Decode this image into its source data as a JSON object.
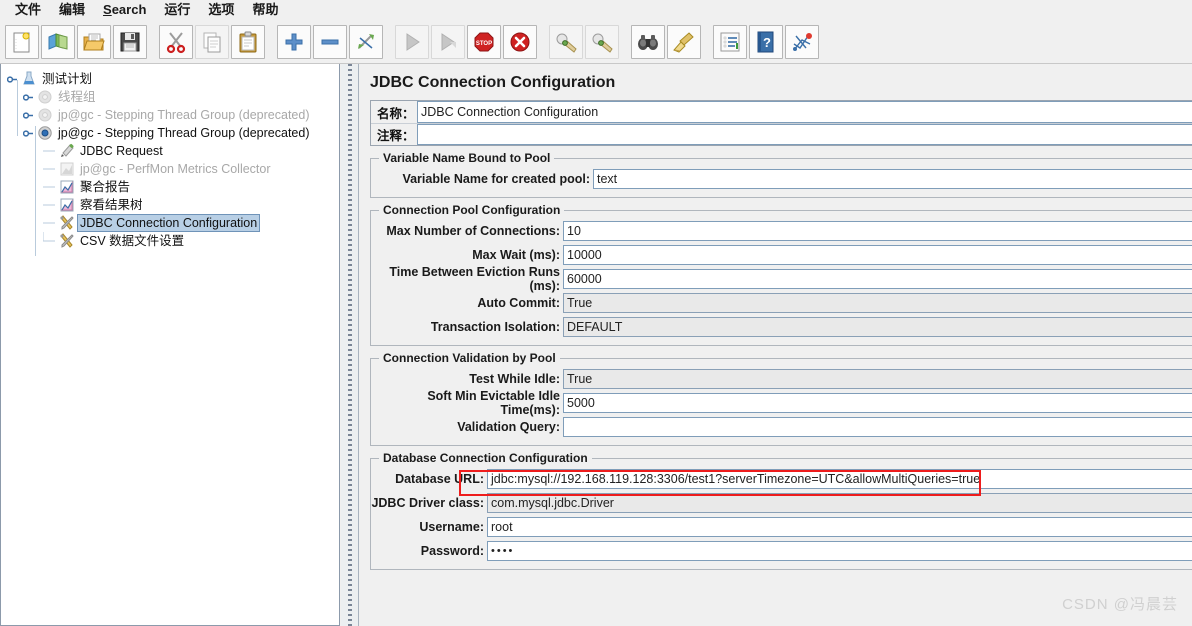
{
  "menu": {
    "items": [
      {
        "label": "文件",
        "mnemonic": ""
      },
      {
        "label": "编辑",
        "mnemonic": ""
      },
      {
        "label": "Search",
        "mnemonic": "S"
      },
      {
        "label": "运行",
        "mnemonic": ""
      },
      {
        "label": "选项",
        "mnemonic": ""
      },
      {
        "label": "帮助",
        "mnemonic": ""
      }
    ]
  },
  "toolbar": {
    "buttons": [
      {
        "name": "new-icon",
        "title": "New"
      },
      {
        "name": "templates-icon",
        "title": "Templates"
      },
      {
        "name": "open-icon",
        "title": "Open"
      },
      {
        "name": "save-icon",
        "title": "Save"
      },
      {
        "name": "cut-icon",
        "title": "Cut"
      },
      {
        "name": "copy-icon",
        "title": "Copy"
      },
      {
        "name": "paste-icon",
        "title": "Paste"
      },
      {
        "name": "expand-icon",
        "title": "Expand All"
      },
      {
        "name": "collapse-icon",
        "title": "Collapse All"
      },
      {
        "name": "toggle-icon",
        "title": "Toggle"
      },
      {
        "name": "start-icon",
        "title": "Start"
      },
      {
        "name": "start-no-pauses-icon",
        "title": "Start no pauses"
      },
      {
        "name": "stop-icon",
        "title": "Stop"
      },
      {
        "name": "shutdown-icon",
        "title": "Shutdown"
      },
      {
        "name": "clear-icon",
        "title": "Clear"
      },
      {
        "name": "clear-all-icon",
        "title": "Clear All"
      },
      {
        "name": "search-icon",
        "title": "Search"
      },
      {
        "name": "search-reset-icon",
        "title": "Reset Search"
      },
      {
        "name": "function-helper-icon",
        "title": "Function Helper Dialog"
      },
      {
        "name": "help-icon",
        "title": "Help"
      },
      {
        "name": "undo-redo-icon",
        "title": "Templates"
      }
    ]
  },
  "tree": {
    "nodes": [
      {
        "label": "测试计划",
        "icon": "test-plan-icon",
        "level": 0,
        "dim": false,
        "selected": false,
        "expander": "expanded"
      },
      {
        "label": "线程组",
        "icon": "thread-group-icon",
        "level": 1,
        "dim": true,
        "selected": false,
        "expander": "collapsed"
      },
      {
        "label": "jp@gc - Stepping Thread Group (deprecated)",
        "icon": "thread-group-icon",
        "level": 1,
        "dim": true,
        "selected": false,
        "expander": "collapsed"
      },
      {
        "label": "jp@gc - Stepping Thread Group (deprecated)",
        "icon": "thread-group-active-icon",
        "level": 1,
        "dim": false,
        "selected": false,
        "expander": "expanded"
      },
      {
        "label": "JDBC Request",
        "icon": "jdbc-request-icon",
        "level": 2,
        "dim": false,
        "selected": false,
        "expander": "none"
      },
      {
        "label": "jp@gc - PerfMon Metrics Collector",
        "icon": "perfmon-icon",
        "level": 2,
        "dim": true,
        "selected": false,
        "expander": "none"
      },
      {
        "label": "聚合报告",
        "icon": "report-icon",
        "level": 2,
        "dim": false,
        "selected": false,
        "expander": "none"
      },
      {
        "label": "察看结果树",
        "icon": "report-icon",
        "level": 2,
        "dim": false,
        "selected": false,
        "expander": "none"
      },
      {
        "label": "JDBC Connection Configuration",
        "icon": "config-icon",
        "level": 2,
        "dim": false,
        "selected": true,
        "expander": "none"
      },
      {
        "label": "CSV 数据文件设置",
        "icon": "config-icon",
        "level": 2,
        "dim": false,
        "selected": false,
        "expander": "none"
      }
    ]
  },
  "panel": {
    "title": "JDBC Connection Configuration",
    "name_label": "名称：",
    "name_value": "JDBC Connection Configuration",
    "comment_label": "注释：",
    "comment_value": "",
    "groups": {
      "variable_name_bound_to_pool": {
        "title": "Variable Name Bound to Pool",
        "fields": [
          {
            "label": "Variable Name for created pool:",
            "value": "text",
            "kind": "input"
          }
        ]
      },
      "connection_pool_configuration": {
        "title": "Connection Pool Configuration",
        "fields": [
          {
            "label": "Max Number of Connections:",
            "value": "10",
            "kind": "input"
          },
          {
            "label": "Max Wait (ms):",
            "value": "10000",
            "kind": "input"
          },
          {
            "label": "Time Between Eviction Runs (ms):",
            "value": "60000",
            "kind": "input"
          },
          {
            "label": "Auto Commit:",
            "value": "True",
            "kind": "combo"
          },
          {
            "label": "Transaction Isolation:",
            "value": "DEFAULT",
            "kind": "combo"
          }
        ]
      },
      "connection_validation_by_pool": {
        "title": "Connection Validation by Pool",
        "fields": [
          {
            "label": "Test While Idle:",
            "value": "True",
            "kind": "combo"
          },
          {
            "label": "Soft Min Evictable Idle Time(ms):",
            "value": "5000",
            "kind": "input"
          },
          {
            "label": "Validation Query:",
            "value": "",
            "kind": "input"
          }
        ]
      },
      "database_connection_configuration": {
        "title": "Database Connection Configuration",
        "fields": [
          {
            "label": "Database URL:",
            "value": "jdbc:mysql://192.168.119.128:3306/test1?serverTimezone=UTC&allowMultiQueries=true",
            "kind": "input"
          },
          {
            "label": "JDBC Driver class:",
            "value": "com.mysql.jdbc.Driver",
            "kind": "combo"
          },
          {
            "label": "Username:",
            "value": "root",
            "kind": "input"
          },
          {
            "label": "Password:",
            "value": "••••",
            "kind": "input"
          }
        ]
      }
    }
  },
  "annotation": {
    "highlight_color": "#ee1c1c",
    "highlight_target": "Database URL"
  },
  "watermark": {
    "text": "CSDN @冯晨芸"
  }
}
